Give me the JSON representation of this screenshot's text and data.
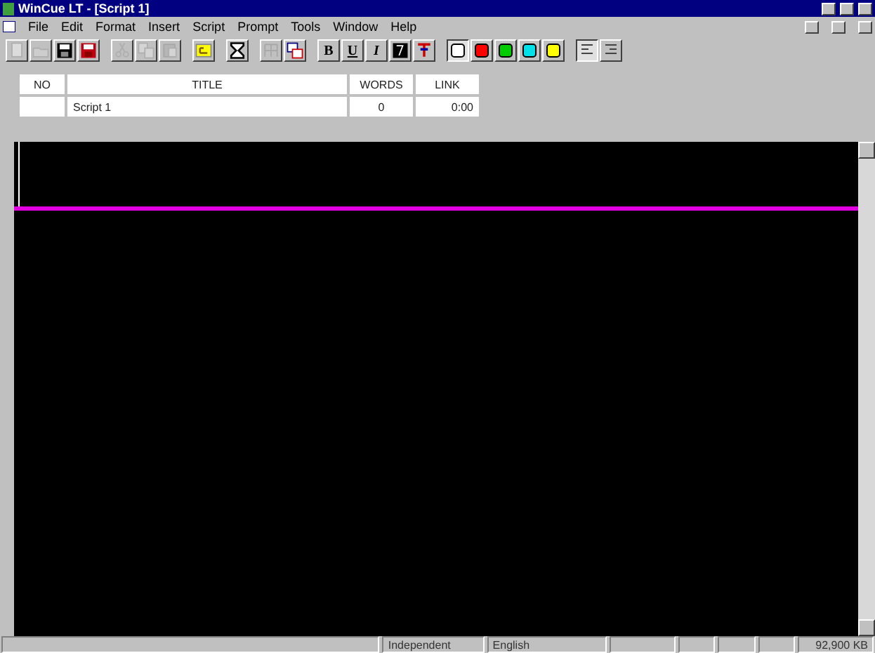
{
  "window": {
    "title": "WinCue LT - [Script 1]"
  },
  "menu": [
    "File",
    "Edit",
    "Format",
    "Insert",
    "Script",
    "Prompt",
    "Tools",
    "Window",
    "Help"
  ],
  "toolbar": [
    {
      "kind": "icon",
      "disabled": true
    },
    {
      "kind": "icon",
      "disabled": true
    },
    {
      "kind": "icon",
      "disabled": false
    },
    {
      "kind": "icon",
      "disabled": false
    },
    {
      "kind": "gap"
    },
    {
      "kind": "icon",
      "disabled": true
    },
    {
      "kind": "icon",
      "disabled": true
    },
    {
      "kind": "icon",
      "disabled": true
    },
    {
      "kind": "gap"
    },
    {
      "kind": "icon",
      "disabled": false
    },
    {
      "kind": "gap"
    },
    {
      "kind": "icon",
      "disabled": false
    },
    {
      "kind": "gap"
    },
    {
      "kind": "icon",
      "disabled": true
    },
    {
      "kind": "icon",
      "disabled": false
    },
    {
      "kind": "gap"
    },
    {
      "kind": "text",
      "label": "B"
    },
    {
      "kind": "text",
      "label": "U"
    },
    {
      "kind": "text",
      "label": "I"
    },
    {
      "kind": "icon",
      "disabled": false
    },
    {
      "kind": "icon",
      "disabled": false
    },
    {
      "kind": "gap"
    }
  ],
  "colors": [
    {
      "color": "#ffffff",
      "selected": true
    },
    {
      "color": "#ff0000",
      "selected": false
    },
    {
      "color": "#00cc00",
      "selected": false
    },
    {
      "color": "#00e0e8",
      "selected": false
    },
    {
      "color": "#ffff00",
      "selected": false
    }
  ],
  "align": [
    {
      "selected": true
    },
    {
      "selected": false
    }
  ],
  "table": {
    "columns": [
      "NO",
      "TITLE",
      "WORDS",
      "LINK"
    ],
    "rows": [
      [
        "",
        "Script 1",
        "0",
        "0:00"
      ]
    ]
  },
  "status_bar": {
    "mode": "Independent",
    "language": "English",
    "memory": "92,900 KB"
  }
}
